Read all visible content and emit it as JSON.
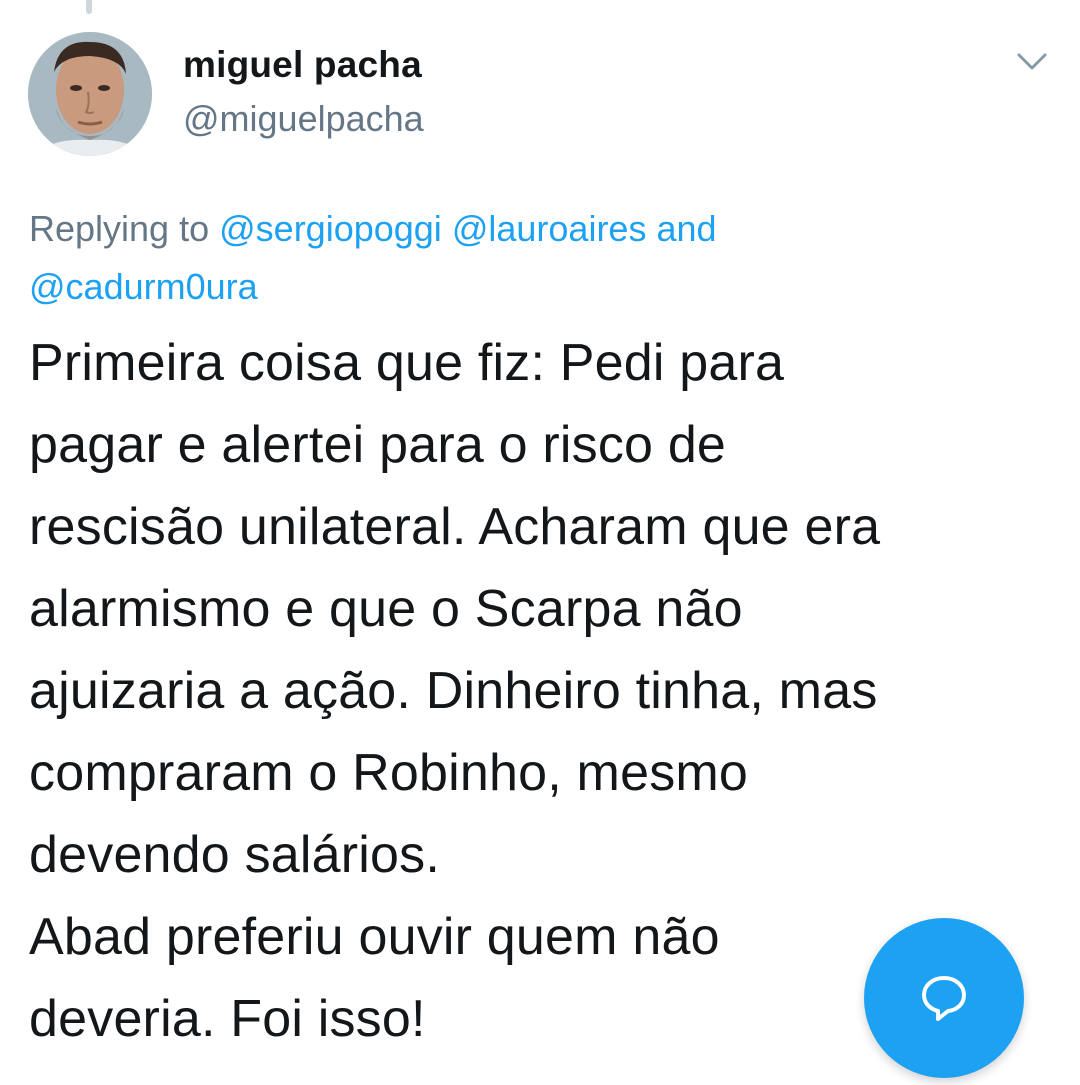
{
  "tweet": {
    "author": {
      "display_name": "miguel pacha",
      "handle": "@miguelpacha"
    },
    "replying": {
      "prefix": "Replying to",
      "mentions": [
        "@sergiopoggi",
        "@lauroaires",
        "@cadurm0ura"
      ],
      "conjunction": "and"
    },
    "text": "Primeira coisa que fiz: Pedi para\npagar e alertei para o risco de\nrescisão unilateral. Acharam que era\nalarmismo e que o Scarpa não\najuizaria a ação. Dinheiro tinha, mas\ncompraram o Robinho, mesmo\ndevendo salários.\nAbad preferiu ouvir quem não\ndeveria. Foi isso!"
  },
  "icons": {
    "menu": "chevron-down-icon",
    "compose": "reply-bubble-icon"
  },
  "colors": {
    "accent": "#1da1f2",
    "secondary_text": "#657786",
    "primary_text": "#14171a"
  }
}
